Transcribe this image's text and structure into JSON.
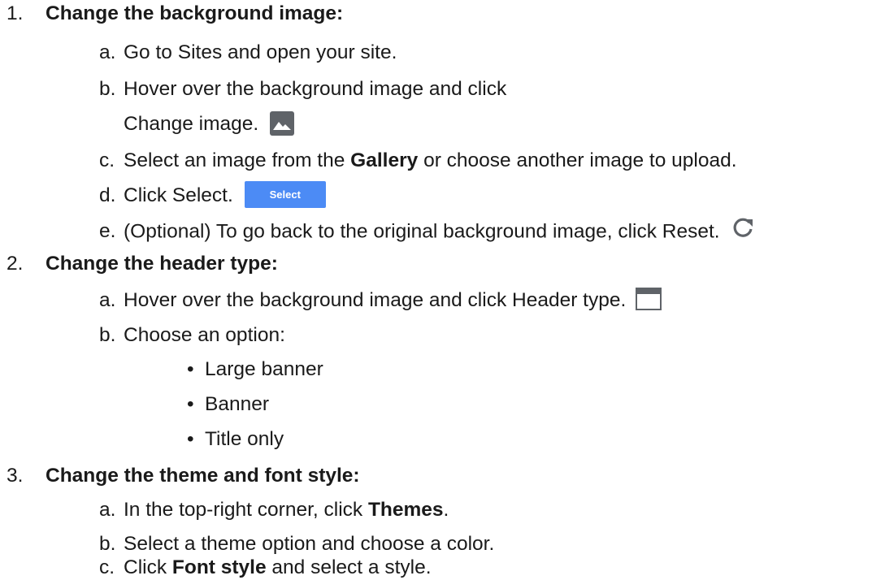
{
  "sections": [
    {
      "num": "1.",
      "title": "Change the background image:",
      "steps": {
        "a": {
          "letter": "a.",
          "text": "Go to Sites and open your site."
        },
        "b": {
          "letter": "b.",
          "text": "Hover over the background image and click",
          "cont": "Change image."
        },
        "c": {
          "letter": "c.",
          "pre": "Select an image from the ",
          "bold": "Gallery",
          "post": " or choose another image to upload."
        },
        "d": {
          "letter": "d.",
          "text": "Click Select.",
          "button": "Select"
        },
        "e": {
          "letter": "e.",
          "text": "(Optional) To go back to the original background image, click Reset."
        }
      }
    },
    {
      "num": "2.",
      "title": "Change the header type:",
      "steps": {
        "a": {
          "letter": "a.",
          "text": "Hover over the background image and click Header type."
        },
        "b": {
          "letter": "b.",
          "text": "Choose an option:"
        }
      },
      "options": [
        "Large banner",
        "Banner",
        "Title only"
      ],
      "bullet": "•"
    },
    {
      "num": "3.",
      "title": "Change the theme and font style:",
      "steps": {
        "a": {
          "letter": "a.",
          "pre": "In the top-right corner, click ",
          "bold": "Themes",
          "post": "."
        },
        "b": {
          "letter": "b.",
          "text": "Select a theme option and choose a color."
        },
        "c": {
          "letter": "c.",
          "pre": "Click ",
          "bold": "Font style",
          "post": " and select a style."
        }
      }
    }
  ],
  "icons": {
    "change_image": "image-icon",
    "reset": "refresh-icon",
    "header_type": "header-layout-icon"
  },
  "colors": {
    "text": "#1a1a1a",
    "icon_gray": "#5f6368",
    "select_button": "#4c8bf5"
  }
}
